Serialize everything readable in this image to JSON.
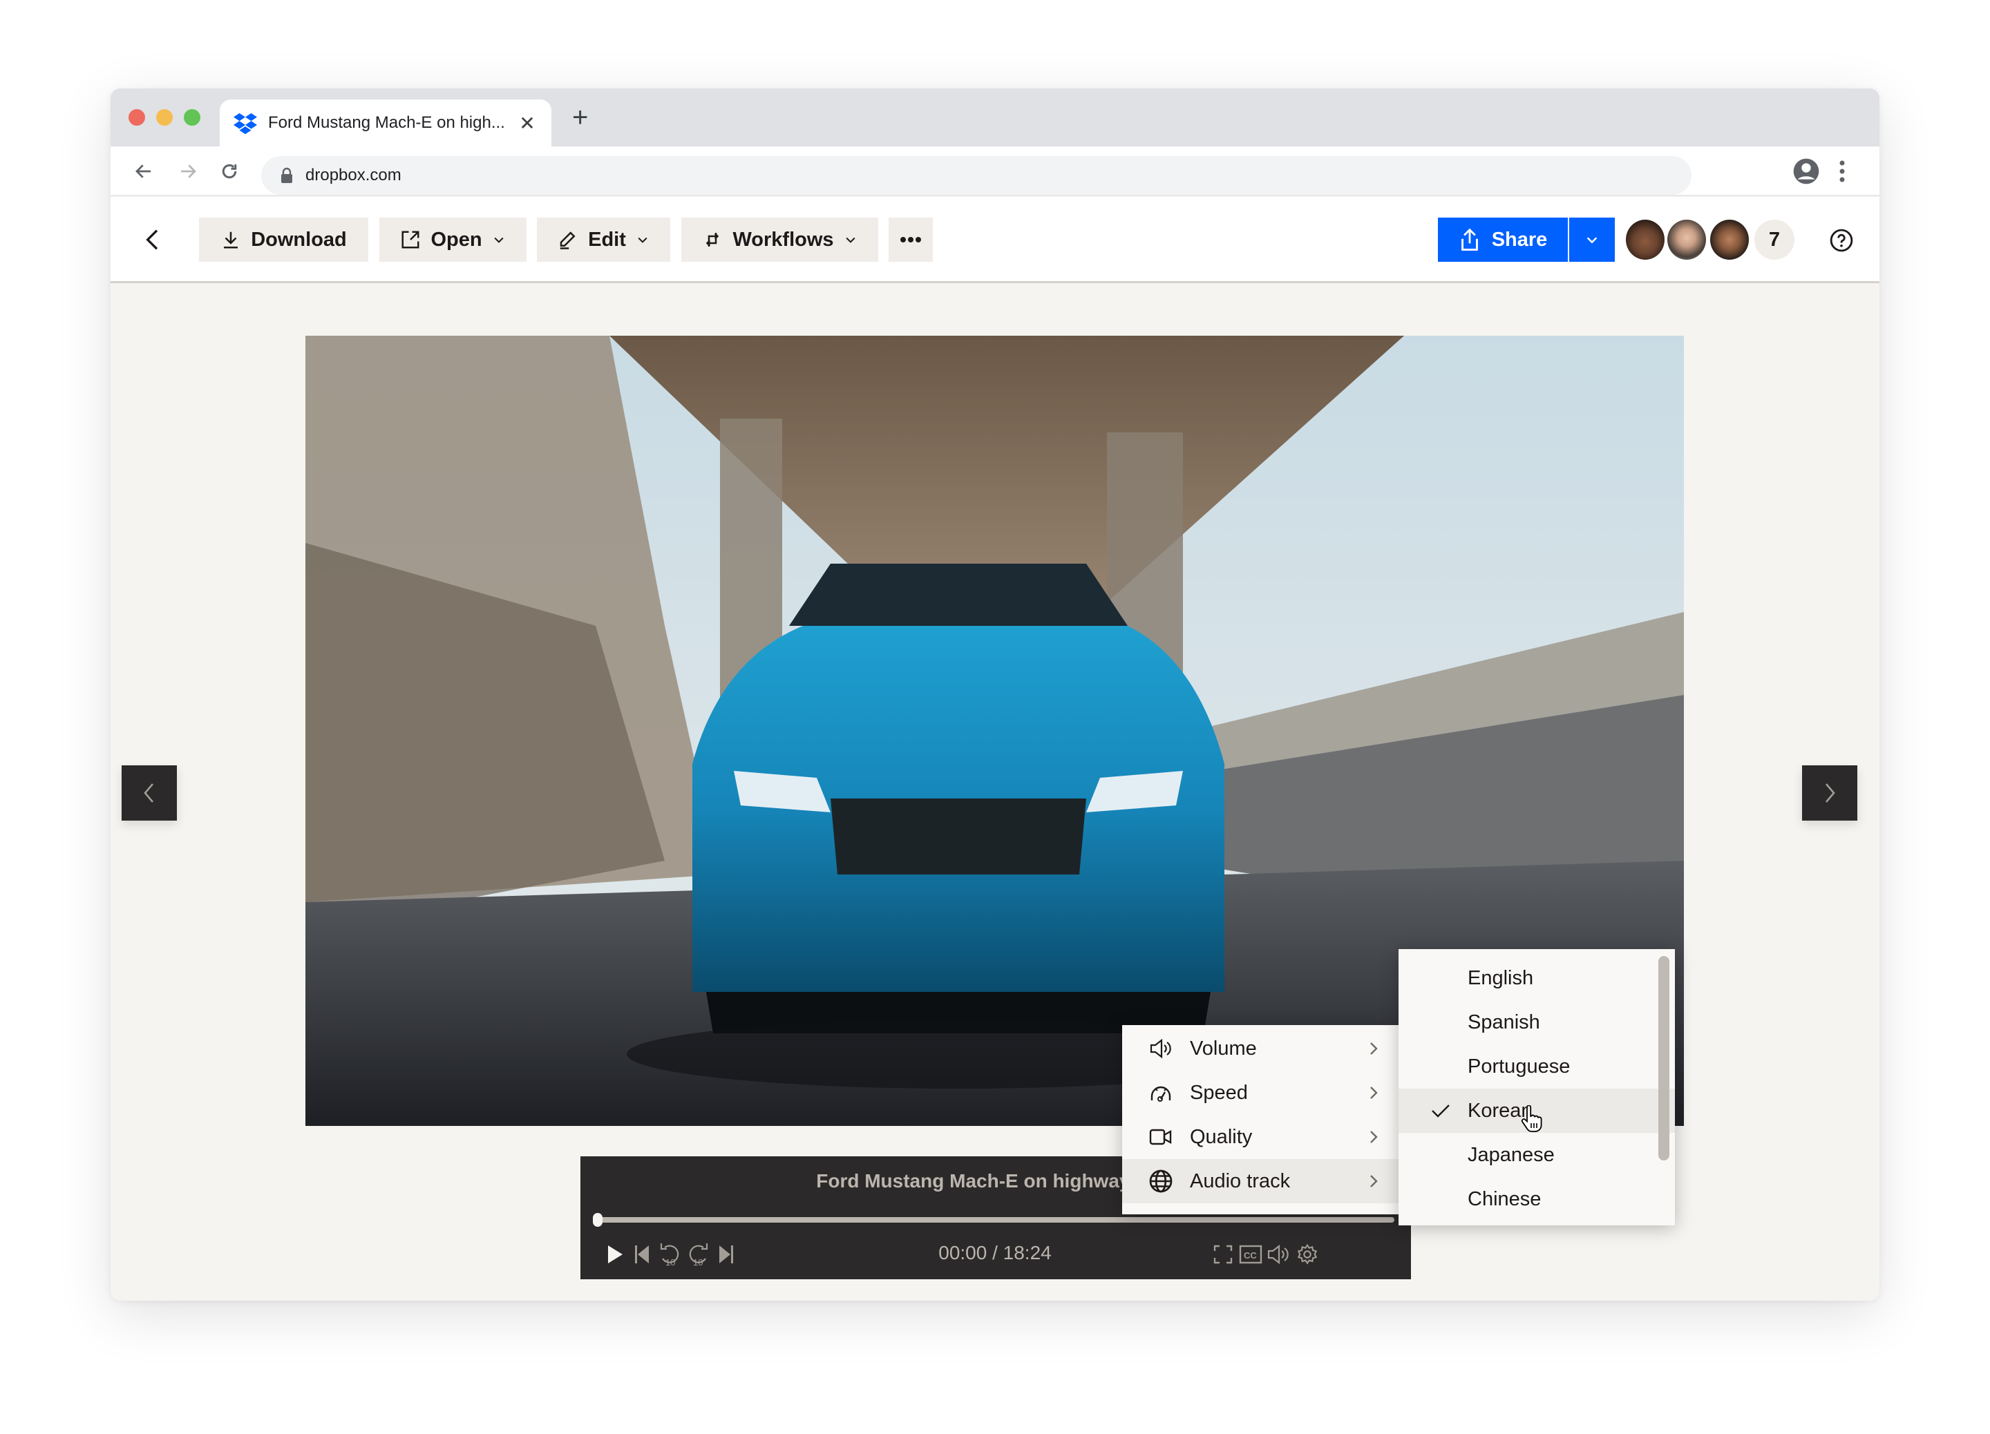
{
  "browser": {
    "tab": {
      "title": "Ford Mustang Mach-E on high...",
      "favicon": "dropbox-icon",
      "close_icon": "close-icon"
    },
    "new_tab_icon": "plus-icon",
    "nav": {
      "back_icon": "arrow-left-icon",
      "forward_icon": "arrow-right-icon",
      "reload_icon": "reload-icon"
    },
    "address": {
      "lock_icon": "lock-icon",
      "url": "dropbox.com"
    },
    "profile_icon": "profile-icon",
    "menu_icon": "kebab-icon"
  },
  "toolbar": {
    "back_icon": "chevron-left-icon",
    "buttons": [
      {
        "label": "Download",
        "icon": "download-icon",
        "dropdown": false
      },
      {
        "label": "Open",
        "icon": "open-external-icon",
        "dropdown": true
      },
      {
        "label": "Edit",
        "icon": "pencil-icon",
        "dropdown": true
      },
      {
        "label": "Workflows",
        "icon": "workflows-icon",
        "dropdown": true
      }
    ],
    "more_icon": "more-horizontal-icon",
    "share": {
      "label": "Share",
      "icon": "share-icon",
      "dropdown_icon": "chevron-down-icon",
      "color": "#0061fe"
    },
    "collaborators": {
      "avatars": [
        "avatar-1",
        "avatar-2",
        "avatar-3"
      ],
      "extra_count": "7"
    },
    "help_icon": "help-icon"
  },
  "viewer": {
    "prev_icon": "chevron-left-icon",
    "next_icon": "chevron-right-icon",
    "media_description": "Blue Ford Mustang Mach-E driving under highway overpass"
  },
  "player": {
    "title": "Ford Mustang Mach-E on highway.mov",
    "progress": 0,
    "current_time": "00:00",
    "duration": "18:24",
    "time_display": "00:00 / 18:24",
    "controls_left": [
      "play-icon",
      "skip-previous-icon",
      "rewind-10-icon",
      "forward-10-icon",
      "skip-next-icon"
    ],
    "controls_right": [
      "fullscreen-icon",
      "closed-captions-icon",
      "volume-icon",
      "settings-icon"
    ]
  },
  "settings_menu": {
    "items": [
      {
        "label": "Volume",
        "icon": "volume-icon",
        "active": false
      },
      {
        "label": "Speed",
        "icon": "speedometer-icon",
        "active": false
      },
      {
        "label": "Quality",
        "icon": "video-camera-icon",
        "active": false
      },
      {
        "label": "Audio track",
        "icon": "globe-icon",
        "active": true
      }
    ]
  },
  "audio_track_menu": {
    "options": [
      "English",
      "Spanish",
      "Portuguese",
      "Korean",
      "Japanese",
      "Chinese"
    ],
    "selected": "Korean"
  }
}
